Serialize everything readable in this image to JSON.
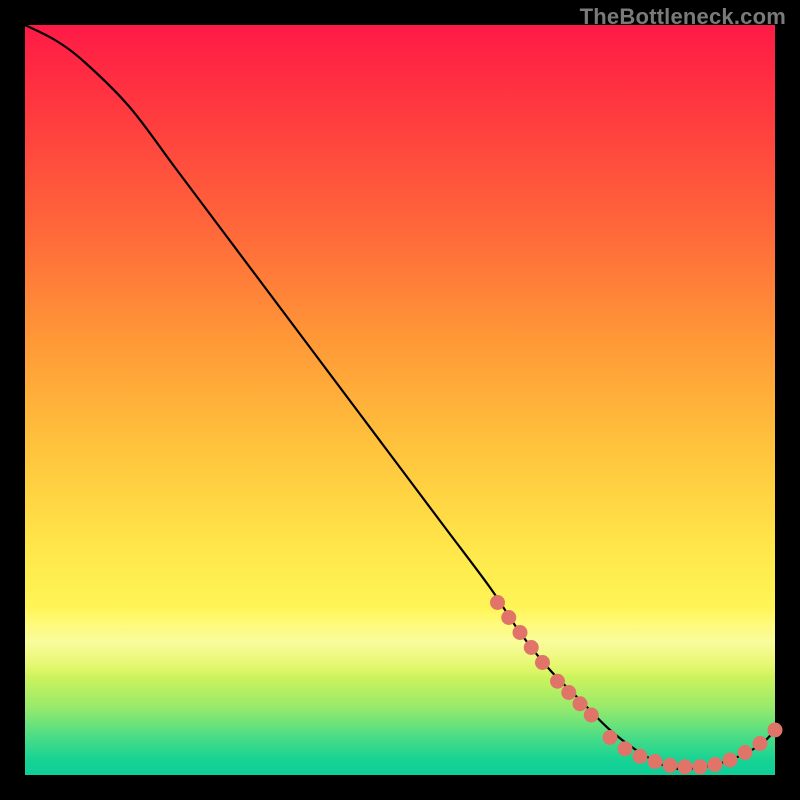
{
  "watermark": "TheBottleneck.com",
  "colors": {
    "background": "#000000",
    "curve": "#000000",
    "dots": "#e07468",
    "watermark_text": "#7a7a7a"
  },
  "chart_data": {
    "type": "line",
    "title": "",
    "xlabel": "",
    "ylabel": "",
    "xlim": [
      0,
      100
    ],
    "ylim": [
      0,
      100
    ],
    "grid": false,
    "legend": false,
    "series": [
      {
        "name": "curve",
        "x": [
          0,
          4,
          8,
          14,
          20,
          26,
          32,
          38,
          44,
          50,
          56,
          62,
          66,
          70,
          74,
          78,
          82,
          86,
          90,
          94,
          98,
          100
        ],
        "y": [
          100,
          98,
          95,
          89,
          81,
          73,
          65,
          57,
          49,
          41,
          33,
          25,
          19,
          14,
          10,
          6,
          3,
          1,
          1,
          2,
          4,
          6
        ]
      }
    ],
    "dot_clusters": [
      {
        "name": "upper-run",
        "x": [
          63,
          64.5,
          66,
          67.5,
          69
        ],
        "y": [
          23,
          21,
          19,
          17,
          15
        ]
      },
      {
        "name": "mid-run",
        "x": [
          71,
          72.5,
          74,
          75.5
        ],
        "y": [
          12.5,
          11,
          9.5,
          8
        ]
      },
      {
        "name": "trough",
        "x": [
          78,
          80,
          82,
          84,
          86,
          88,
          90,
          92,
          94,
          96,
          98
        ],
        "y": [
          5,
          3.5,
          2.5,
          1.8,
          1.3,
          1.1,
          1.1,
          1.4,
          2.0,
          3.0,
          4.2
        ]
      },
      {
        "name": "end",
        "x": [
          100
        ],
        "y": [
          6
        ]
      }
    ],
    "annotations": []
  }
}
